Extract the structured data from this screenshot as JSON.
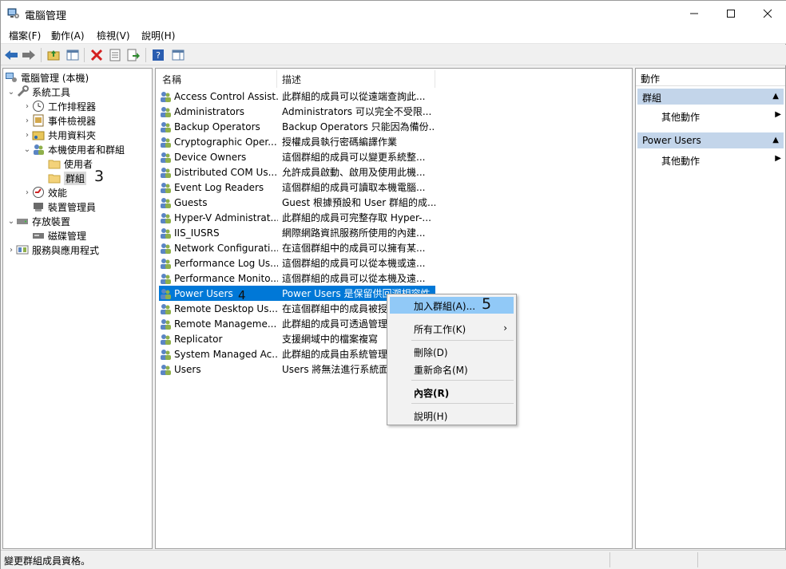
{
  "window": {
    "title": "電腦管理"
  },
  "menu": [
    "檔案(F)",
    "動作(A)",
    "檢視(V)",
    "說明(H)"
  ],
  "tree": [
    {
      "label": "電腦管理 (本機)",
      "icon": "computer-management-icon"
    },
    {
      "label": "系統工具",
      "icon": "tools-icon"
    },
    {
      "label": "工作排程器",
      "icon": "clock-icon"
    },
    {
      "label": "事件檢視器",
      "icon": "event-viewer-icon"
    },
    {
      "label": "共用資料夾",
      "icon": "shared-folder-icon"
    },
    {
      "label": "本機使用者和群組",
      "icon": "users-icon"
    },
    {
      "label": "使用者",
      "icon": "folder-icon"
    },
    {
      "label": "群組",
      "icon": "folder-icon"
    },
    {
      "label": "效能",
      "icon": "performance-icon"
    },
    {
      "label": "裝置管理員",
      "icon": "device-manager-icon"
    },
    {
      "label": "存放裝置",
      "icon": "storage-icon"
    },
    {
      "label": "磁碟管理",
      "icon": "disk-icon"
    },
    {
      "label": "服務與應用程式",
      "icon": "services-icon"
    }
  ],
  "columns": {
    "name": "名稱",
    "description": "描述"
  },
  "groups": [
    {
      "name": "Access Control Assist...",
      "desc": "此群組的成員可以從遠端查詢此..."
    },
    {
      "name": "Administrators",
      "desc": "Administrators 可以完全不受限..."
    },
    {
      "name": "Backup Operators",
      "desc": "Backup Operators 只能因為備份..."
    },
    {
      "name": "Cryptographic Oper...",
      "desc": "授權成員執行密碼編譯作業"
    },
    {
      "name": "Device Owners",
      "desc": "這個群組的成員可以變更系統整..."
    },
    {
      "name": "Distributed COM Us...",
      "desc": "允許成員啟動、啟用及使用此機..."
    },
    {
      "name": "Event Log Readers",
      "desc": "這個群組的成員可讀取本機電腦..."
    },
    {
      "name": "Guests",
      "desc": "Guest 根據預設和 User 群組的成..."
    },
    {
      "name": "Hyper-V Administrat...",
      "desc": "此群組的成員可完整存取 Hyper-..."
    },
    {
      "name": "IIS_IUSRS",
      "desc": "網際網路資訊服務所使用的內建..."
    },
    {
      "name": "Network Configurati...",
      "desc": "在這個群組中的成員可以擁有某..."
    },
    {
      "name": "Performance Log Us...",
      "desc": "這個群組的成員可以從本機或遠..."
    },
    {
      "name": "Performance Monito...",
      "desc": "這個群組的成員可以從本機及遠..."
    },
    {
      "name": "Power Users",
      "desc": "Power Users 是保留供回溯相容性"
    },
    {
      "name": "Remote Desktop Us...",
      "desc": "在這個群組中的成員被授"
    },
    {
      "name": "Remote Manageme...",
      "desc": "此群組的成員可透過管理"
    },
    {
      "name": "Replicator",
      "desc": "支援網域中的檔案複寫"
    },
    {
      "name": "System Managed Ac...",
      "desc": "此群組的成員由系統管理"
    },
    {
      "name": "Users",
      "desc": "Users 將無法進行系統面"
    }
  ],
  "actions": {
    "title": "動作",
    "sections": [
      {
        "header": "群組",
        "item": "其他動作"
      },
      {
        "header": "Power Users",
        "item": "其他動作"
      }
    ]
  },
  "context_menu": {
    "add_to_group": "加入群組(A)...",
    "all_tasks": "所有工作(K)",
    "delete": "刪除(D)",
    "rename": "重新命名(M)",
    "properties": "內容(R)",
    "help": "說明(H)"
  },
  "annotations": {
    "step3": "3",
    "step4": "4",
    "step5": "5"
  },
  "status": {
    "text": "變更群組成員資格。"
  },
  "colors": {
    "selection": "#0078d7",
    "menu_highlight": "#91c9f7",
    "action_header": "#c3d5ea"
  }
}
